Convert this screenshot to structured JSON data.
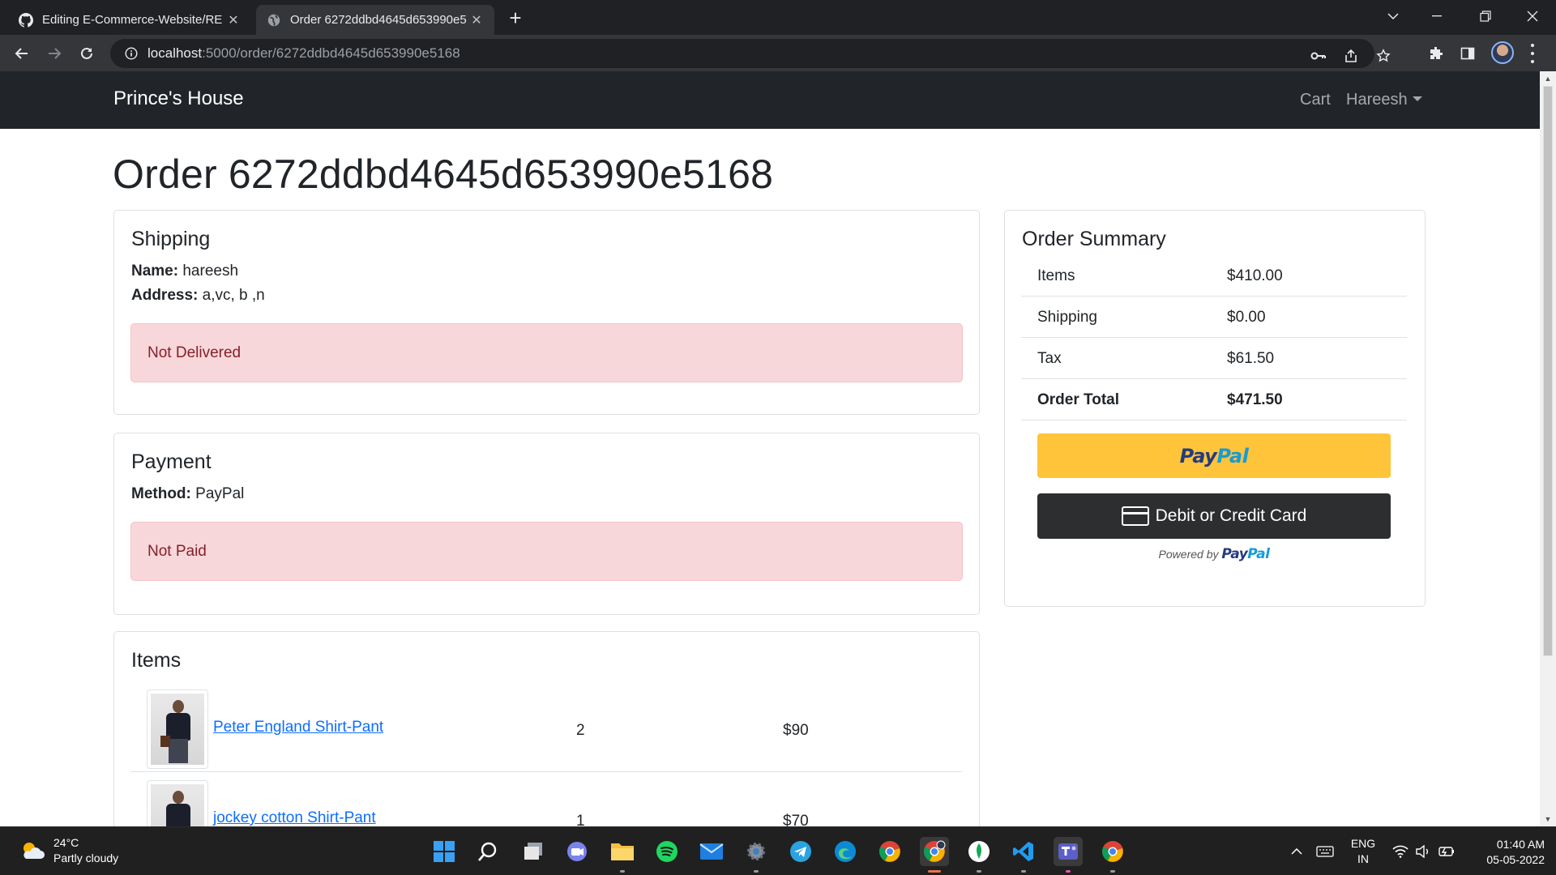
{
  "browser": {
    "tabs": [
      {
        "title": "Editing E-Commerce-Website/RE",
        "icon": "github-icon",
        "active": false
      },
      {
        "title": "Order 6272ddbd4645d653990e5",
        "icon": "globe-icon",
        "active": true
      }
    ],
    "url_host": "localhost",
    "url_path": ":5000/order/6272ddbd4645d653990e5168"
  },
  "site": {
    "brand": "Prince's House",
    "nav": {
      "cart": "Cart",
      "user": "Hareesh"
    }
  },
  "order": {
    "title": "Order 6272ddbd4645d653990e5168",
    "shipping": {
      "heading": "Shipping",
      "name_label": "Name:",
      "name": "hareesh",
      "address_label": "Address:",
      "address": "a,vc, b ,n",
      "status": "Not Delivered"
    },
    "payment": {
      "heading": "Payment",
      "method_label": "Method:",
      "method": "PayPal",
      "status": "Not Paid"
    },
    "items": {
      "heading": "Items",
      "rows": [
        {
          "name": "Peter England Shirt-Pant",
          "qty": "2",
          "price": "$90"
        },
        {
          "name": "jockey cotton Shirt-Pant",
          "qty": "1",
          "price": "$70"
        }
      ]
    },
    "summary": {
      "heading": "Order Summary",
      "rows": [
        {
          "label": "Items",
          "value": "$410.00"
        },
        {
          "label": "Shipping",
          "value": "$0.00"
        },
        {
          "label": "Tax",
          "value": "$61.50"
        },
        {
          "label": "Order Total",
          "value": "$471.50"
        }
      ],
      "paypal_pay": "Pay",
      "paypal_pal": "Pal",
      "card_button": "Debit or Credit Card",
      "powered_by": "Powered by"
    }
  },
  "taskbar": {
    "temperature": "24°C",
    "weather": "Partly cloudy",
    "lang": "ENG",
    "region": "IN",
    "time": "01:40 AM",
    "date": "05-05-2022"
  },
  "colors": {
    "navbar": "#212529",
    "alert_bg": "#f8d7da",
    "alert_text": "#842029",
    "link": "#0d6efd",
    "paypal_gold": "#ffc439",
    "paypal_dark": "#2c2e2f"
  }
}
